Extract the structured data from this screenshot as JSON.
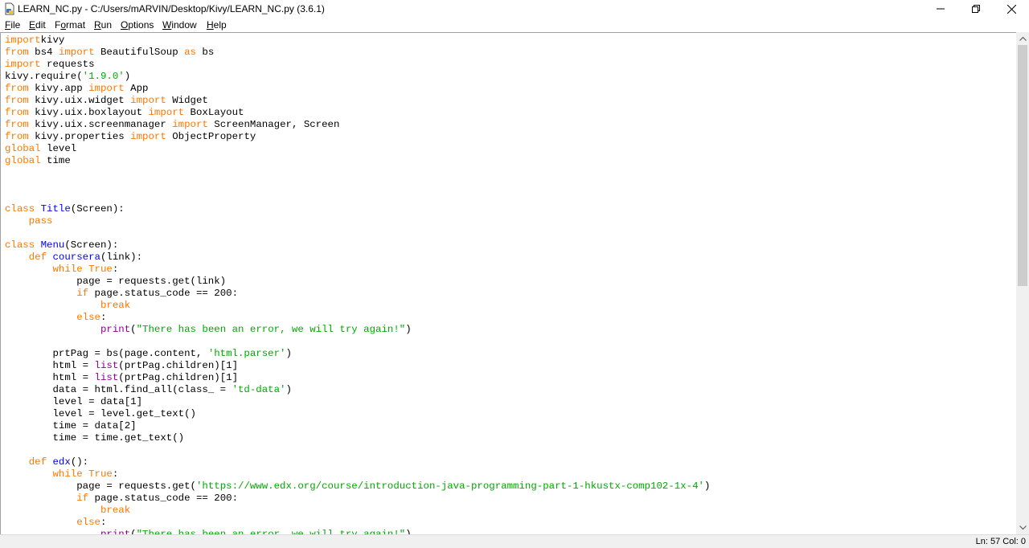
{
  "window": {
    "title": "LEARN_NC.py - C:/Users/mARVIN/Desktop/Kivy/LEARN_NC.py (3.6.1)"
  },
  "menu": [
    {
      "accel": "F",
      "rest": "ile"
    },
    {
      "accel": "E",
      "rest": "dit"
    },
    {
      "pre": "F",
      "accel": "o",
      "rest": "rmat"
    },
    {
      "accel": "R",
      "rest": "un"
    },
    {
      "accel": "O",
      "rest": "ptions"
    },
    {
      "accel": "W",
      "rest": "indow"
    },
    {
      "accel": "H",
      "rest": "elp"
    }
  ],
  "colors": {
    "keyword": "#ff7700",
    "builtin": "#900090",
    "string": "#00aa00",
    "definition": "#0000ff"
  },
  "code_lines": [
    [
      [
        "kw",
        "import"
      ],
      [
        "",
        "kivy"
      ]
    ],
    [
      [
        "kw",
        "from"
      ],
      [
        "",
        " bs4 "
      ],
      [
        "kw",
        "import"
      ],
      [
        "",
        " BeautifulSoup "
      ],
      [
        "kw",
        "as"
      ],
      [
        "",
        " bs"
      ]
    ],
    [
      [
        "kw",
        "import"
      ],
      [
        "",
        " requests"
      ]
    ],
    [
      [
        "",
        "kivy.require("
      ],
      [
        "st",
        "'1.9.0'"
      ],
      [
        "",
        ")"
      ]
    ],
    [
      [
        "kw",
        "from"
      ],
      [
        "",
        " kivy.app "
      ],
      [
        "kw",
        "import"
      ],
      [
        "",
        " App"
      ]
    ],
    [
      [
        "kw",
        "from"
      ],
      [
        "",
        " kivy.uix.widget "
      ],
      [
        "kw",
        "import"
      ],
      [
        "",
        " Widget"
      ]
    ],
    [
      [
        "kw",
        "from"
      ],
      [
        "",
        " kivy.uix.boxlayout "
      ],
      [
        "kw",
        "import"
      ],
      [
        "",
        " BoxLayout"
      ]
    ],
    [
      [
        "kw",
        "from"
      ],
      [
        "",
        " kivy.uix.screenmanager "
      ],
      [
        "kw",
        "import"
      ],
      [
        "",
        " ScreenManager, Screen"
      ]
    ],
    [
      [
        "kw",
        "from"
      ],
      [
        "",
        " kivy.properties "
      ],
      [
        "kw",
        "import"
      ],
      [
        "",
        " ObjectProperty"
      ]
    ],
    [
      [
        "kw",
        "global"
      ],
      [
        "",
        " level"
      ]
    ],
    [
      [
        "kw",
        "global"
      ],
      [
        "",
        " time"
      ]
    ],
    [],
    [],
    [],
    [
      [
        "kw",
        "class"
      ],
      [
        "",
        " "
      ],
      [
        "df",
        "Title"
      ],
      [
        "",
        "(Screen):"
      ]
    ],
    [
      [
        "",
        "    "
      ],
      [
        "kw",
        "pass"
      ]
    ],
    [],
    [
      [
        "kw",
        "class"
      ],
      [
        "",
        " "
      ],
      [
        "df",
        "Menu"
      ],
      [
        "",
        "(Screen):"
      ]
    ],
    [
      [
        "",
        "    "
      ],
      [
        "kw",
        "def"
      ],
      [
        "",
        " "
      ],
      [
        "df",
        "coursera"
      ],
      [
        "",
        "(link):"
      ]
    ],
    [
      [
        "",
        "        "
      ],
      [
        "kw",
        "while"
      ],
      [
        "",
        " "
      ],
      [
        "kw",
        "True"
      ],
      [
        "",
        ":"
      ]
    ],
    [
      [
        "",
        "            page = requests.get(link)"
      ]
    ],
    [
      [
        "",
        "            "
      ],
      [
        "kw",
        "if"
      ],
      [
        "",
        " page.status_code == 200:"
      ]
    ],
    [
      [
        "",
        "                "
      ],
      [
        "kw",
        "break"
      ]
    ],
    [
      [
        "",
        "            "
      ],
      [
        "kw",
        "else"
      ],
      [
        "",
        ":"
      ]
    ],
    [
      [
        "",
        "                "
      ],
      [
        "bi",
        "print"
      ],
      [
        "",
        "("
      ],
      [
        "st",
        "\"There has been an error, we will try again!\""
      ],
      [
        "",
        ")"
      ]
    ],
    [],
    [
      [
        "",
        "        prtPag = bs(page.content, "
      ],
      [
        "st",
        "'html.parser'"
      ],
      [
        "",
        ")"
      ]
    ],
    [
      [
        "",
        "        html = "
      ],
      [
        "bi",
        "list"
      ],
      [
        "",
        "(prtPag.children)[1]"
      ]
    ],
    [
      [
        "",
        "        html = "
      ],
      [
        "bi",
        "list"
      ],
      [
        "",
        "(prtPag.children)[1]"
      ]
    ],
    [
      [
        "",
        "        data = html.find_all(class_ = "
      ],
      [
        "st",
        "'td-data'"
      ],
      [
        "",
        ")"
      ]
    ],
    [
      [
        "",
        "        level = data[1]"
      ]
    ],
    [
      [
        "",
        "        level = level.get_text()"
      ]
    ],
    [
      [
        "",
        "        time = data[2]"
      ]
    ],
    [
      [
        "",
        "        time = time.get_text()"
      ]
    ],
    [],
    [
      [
        "",
        "    "
      ],
      [
        "kw",
        "def"
      ],
      [
        "",
        " "
      ],
      [
        "df",
        "edx"
      ],
      [
        "",
        "():"
      ]
    ],
    [
      [
        "",
        "        "
      ],
      [
        "kw",
        "while"
      ],
      [
        "",
        " "
      ],
      [
        "kw",
        "True"
      ],
      [
        "",
        ":"
      ]
    ],
    [
      [
        "",
        "            page = requests.get("
      ],
      [
        "st",
        "'https://www.edx.org/course/introduction-java-programming-part-1-hkustx-comp102-1x-4'"
      ],
      [
        "",
        ")"
      ]
    ],
    [
      [
        "",
        "            "
      ],
      [
        "kw",
        "if"
      ],
      [
        "",
        " page.status_code == 200:"
      ]
    ],
    [
      [
        "",
        "                "
      ],
      [
        "kw",
        "break"
      ]
    ],
    [
      [
        "",
        "            "
      ],
      [
        "kw",
        "else"
      ],
      [
        "",
        ":"
      ]
    ],
    [
      [
        "",
        "                "
      ],
      [
        "bi",
        "print"
      ],
      [
        "",
        "("
      ],
      [
        "st",
        "\"There has been an error, we will try again!\""
      ],
      [
        "",
        ")"
      ]
    ]
  ],
  "status": {
    "line_col": "Ln: 57   Col: 0"
  }
}
